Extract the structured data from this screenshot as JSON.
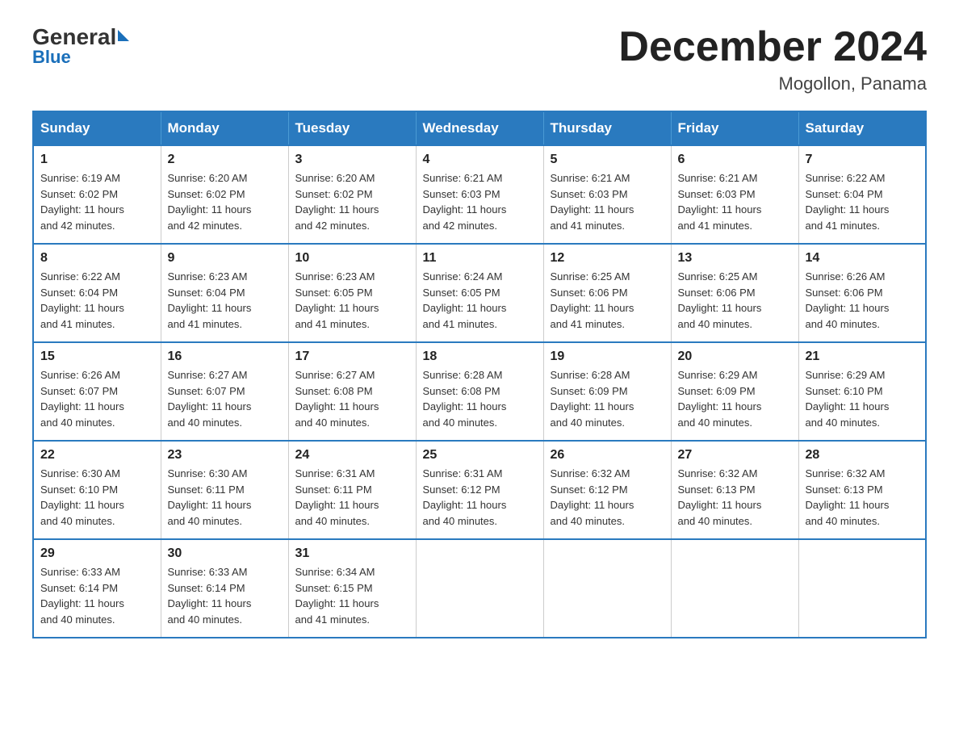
{
  "logo": {
    "general": "General",
    "blue": "Blue",
    "subtitle": "Blue"
  },
  "header": {
    "title": "December 2024",
    "location": "Mogollon, Panama"
  },
  "days_of_week": [
    "Sunday",
    "Monday",
    "Tuesday",
    "Wednesday",
    "Thursday",
    "Friday",
    "Saturday"
  ],
  "weeks": [
    [
      {
        "day": "1",
        "sunrise": "6:19 AM",
        "sunset": "6:02 PM",
        "daylight": "11 hours and 42 minutes."
      },
      {
        "day": "2",
        "sunrise": "6:20 AM",
        "sunset": "6:02 PM",
        "daylight": "11 hours and 42 minutes."
      },
      {
        "day": "3",
        "sunrise": "6:20 AM",
        "sunset": "6:02 PM",
        "daylight": "11 hours and 42 minutes."
      },
      {
        "day": "4",
        "sunrise": "6:21 AM",
        "sunset": "6:03 PM",
        "daylight": "11 hours and 42 minutes."
      },
      {
        "day": "5",
        "sunrise": "6:21 AM",
        "sunset": "6:03 PM",
        "daylight": "11 hours and 41 minutes."
      },
      {
        "day": "6",
        "sunrise": "6:21 AM",
        "sunset": "6:03 PM",
        "daylight": "11 hours and 41 minutes."
      },
      {
        "day": "7",
        "sunrise": "6:22 AM",
        "sunset": "6:04 PM",
        "daylight": "11 hours and 41 minutes."
      }
    ],
    [
      {
        "day": "8",
        "sunrise": "6:22 AM",
        "sunset": "6:04 PM",
        "daylight": "11 hours and 41 minutes."
      },
      {
        "day": "9",
        "sunrise": "6:23 AM",
        "sunset": "6:04 PM",
        "daylight": "11 hours and 41 minutes."
      },
      {
        "day": "10",
        "sunrise": "6:23 AM",
        "sunset": "6:05 PM",
        "daylight": "11 hours and 41 minutes."
      },
      {
        "day": "11",
        "sunrise": "6:24 AM",
        "sunset": "6:05 PM",
        "daylight": "11 hours and 41 minutes."
      },
      {
        "day": "12",
        "sunrise": "6:25 AM",
        "sunset": "6:06 PM",
        "daylight": "11 hours and 41 minutes."
      },
      {
        "day": "13",
        "sunrise": "6:25 AM",
        "sunset": "6:06 PM",
        "daylight": "11 hours and 40 minutes."
      },
      {
        "day": "14",
        "sunrise": "6:26 AM",
        "sunset": "6:06 PM",
        "daylight": "11 hours and 40 minutes."
      }
    ],
    [
      {
        "day": "15",
        "sunrise": "6:26 AM",
        "sunset": "6:07 PM",
        "daylight": "11 hours and 40 minutes."
      },
      {
        "day": "16",
        "sunrise": "6:27 AM",
        "sunset": "6:07 PM",
        "daylight": "11 hours and 40 minutes."
      },
      {
        "day": "17",
        "sunrise": "6:27 AM",
        "sunset": "6:08 PM",
        "daylight": "11 hours and 40 minutes."
      },
      {
        "day": "18",
        "sunrise": "6:28 AM",
        "sunset": "6:08 PM",
        "daylight": "11 hours and 40 minutes."
      },
      {
        "day": "19",
        "sunrise": "6:28 AM",
        "sunset": "6:09 PM",
        "daylight": "11 hours and 40 minutes."
      },
      {
        "day": "20",
        "sunrise": "6:29 AM",
        "sunset": "6:09 PM",
        "daylight": "11 hours and 40 minutes."
      },
      {
        "day": "21",
        "sunrise": "6:29 AM",
        "sunset": "6:10 PM",
        "daylight": "11 hours and 40 minutes."
      }
    ],
    [
      {
        "day": "22",
        "sunrise": "6:30 AM",
        "sunset": "6:10 PM",
        "daylight": "11 hours and 40 minutes."
      },
      {
        "day": "23",
        "sunrise": "6:30 AM",
        "sunset": "6:11 PM",
        "daylight": "11 hours and 40 minutes."
      },
      {
        "day": "24",
        "sunrise": "6:31 AM",
        "sunset": "6:11 PM",
        "daylight": "11 hours and 40 minutes."
      },
      {
        "day": "25",
        "sunrise": "6:31 AM",
        "sunset": "6:12 PM",
        "daylight": "11 hours and 40 minutes."
      },
      {
        "day": "26",
        "sunrise": "6:32 AM",
        "sunset": "6:12 PM",
        "daylight": "11 hours and 40 minutes."
      },
      {
        "day": "27",
        "sunrise": "6:32 AM",
        "sunset": "6:13 PM",
        "daylight": "11 hours and 40 minutes."
      },
      {
        "day": "28",
        "sunrise": "6:32 AM",
        "sunset": "6:13 PM",
        "daylight": "11 hours and 40 minutes."
      }
    ],
    [
      {
        "day": "29",
        "sunrise": "6:33 AM",
        "sunset": "6:14 PM",
        "daylight": "11 hours and 40 minutes."
      },
      {
        "day": "30",
        "sunrise": "6:33 AM",
        "sunset": "6:14 PM",
        "daylight": "11 hours and 40 minutes."
      },
      {
        "day": "31",
        "sunrise": "6:34 AM",
        "sunset": "6:15 PM",
        "daylight": "11 hours and 41 minutes."
      },
      null,
      null,
      null,
      null
    ]
  ],
  "labels": {
    "sunrise": "Sunrise:",
    "sunset": "Sunset:",
    "daylight": "Daylight:"
  }
}
